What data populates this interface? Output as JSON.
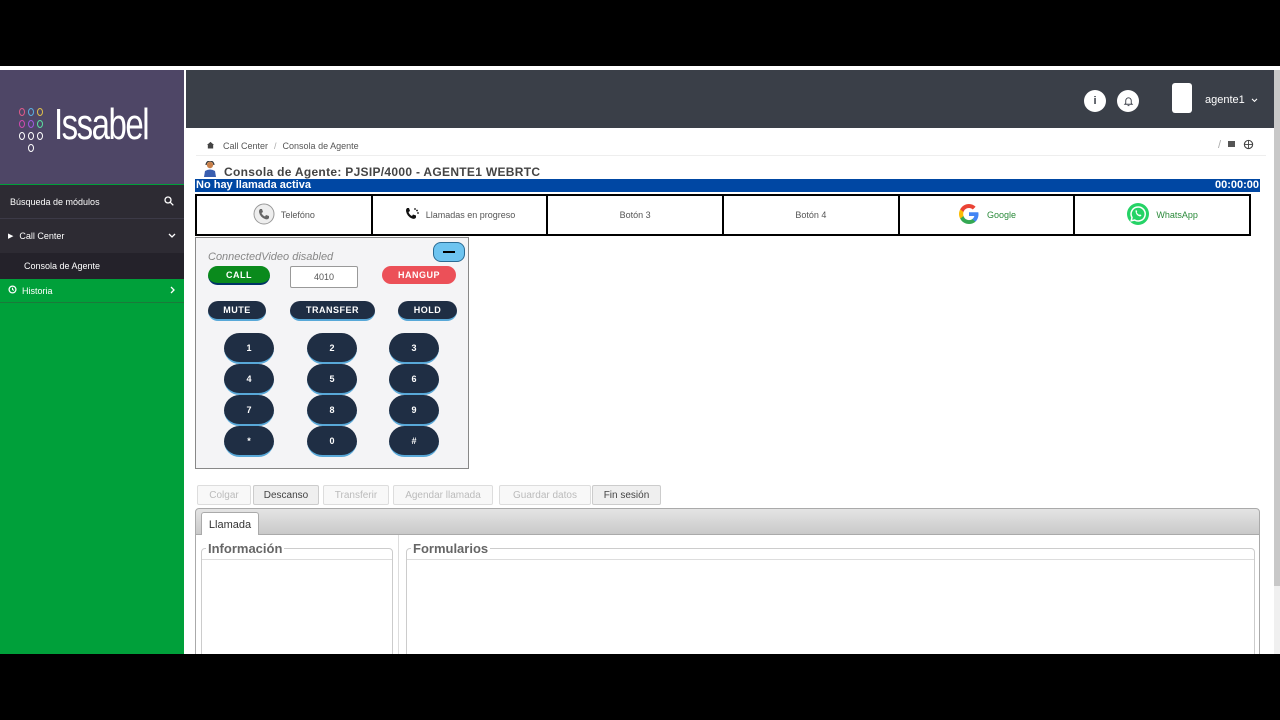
{
  "sidebar": {
    "logo_text": "Issabel",
    "search_label": "Búsqueda de módulos",
    "items": [
      {
        "label": "Call Center"
      },
      {
        "label": "Consola de Agente"
      },
      {
        "label": "Historia"
      }
    ]
  },
  "topbar": {
    "user_name": "agente1"
  },
  "breadcrumb": {
    "items": [
      "Call Center",
      "Consola de Agente"
    ]
  },
  "agent": {
    "title": "Consola de Agente: PJSIP/4000 - AGENTE1 WEBRTC",
    "status": "No hay llamada activa",
    "timer": "00:00:00"
  },
  "quick_buttons": [
    {
      "label": "Telefóno",
      "icon": "phone-icon"
    },
    {
      "label": "Llamadas en progreso",
      "icon": "phone-progress-icon"
    },
    {
      "label": "Botón 3",
      "icon": ""
    },
    {
      "label": "Botón 4",
      "icon": ""
    },
    {
      "label": "Google",
      "icon": "google-icon"
    },
    {
      "label": "WhatsApp",
      "icon": "whatsapp-icon"
    }
  ],
  "phone": {
    "video_status": "ConnectedVideo disabled",
    "call_label": "CALL",
    "number_value": "4010",
    "hangup_label": "HANGUP",
    "mute_label": "MUTE",
    "transfer_label": "TRANSFER",
    "hold_label": "HOLD",
    "keys": [
      "1",
      "2",
      "3",
      "4",
      "5",
      "6",
      "7",
      "8",
      "9",
      "*",
      "0",
      "#"
    ]
  },
  "actions": [
    {
      "label": "Colgar",
      "enabled": false
    },
    {
      "label": "Descanso",
      "enabled": true
    },
    {
      "label": "Transferir",
      "enabled": false
    },
    {
      "label": "Agendar llamada",
      "enabled": false
    },
    {
      "label": "Guardar datos",
      "enabled": false
    },
    {
      "label": "Fin sesión",
      "enabled": true
    }
  ],
  "tabs": {
    "active": "Llamada"
  },
  "panels": {
    "info_legend": "Información",
    "forms_legend": "Formularios"
  },
  "colors": {
    "sidebar_green": "#00a03a",
    "logo_purple": "#4e4666",
    "status_blue": "#0047a3",
    "call_green": "#0a8a1c",
    "hangup_red": "#ec5058",
    "key_navy": "#1f2e44"
  }
}
